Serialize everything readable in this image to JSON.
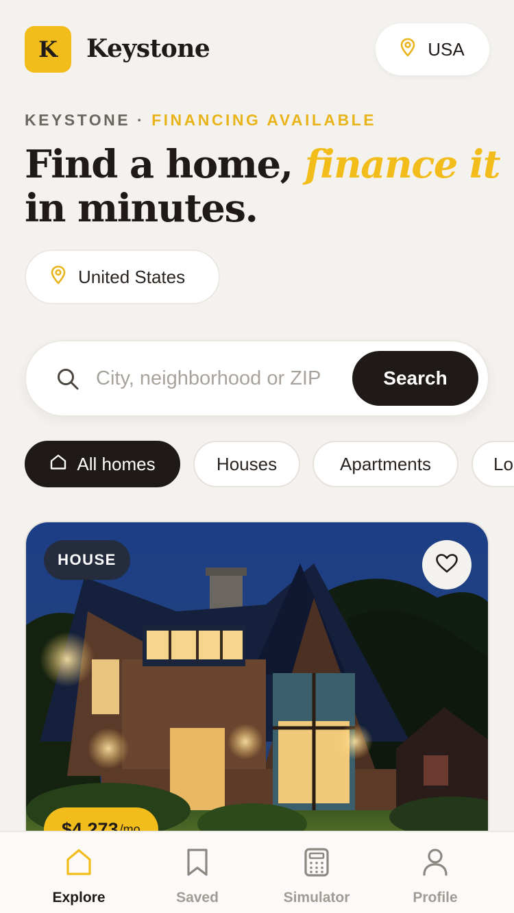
{
  "brand": {
    "logo_letter": "K",
    "name": "Keystone"
  },
  "country_selector": {
    "label": "USA",
    "icon": "location-pin-icon"
  },
  "eyebrow": {
    "brand": "KEYSTONE",
    "separator": " · ",
    "tagline": "FINANCING AVAILABLE"
  },
  "headline": {
    "part1": "Find a home, ",
    "accent": "finance it",
    "part2": "in minutes."
  },
  "location": {
    "label": "United States",
    "icon": "location-pin-icon"
  },
  "search": {
    "placeholder": "City, neighborhood or ZIP",
    "value": "",
    "button_label": "Search",
    "icon": "search-icon"
  },
  "categories": [
    {
      "label": "All homes",
      "active": true,
      "icon": "home-outline-icon"
    },
    {
      "label": "Houses",
      "active": false
    },
    {
      "label": "Apartments",
      "active": false
    },
    {
      "label": "Lo",
      "active": false
    }
  ],
  "listing": {
    "type_badge": "HOUSE",
    "price": "$4,273",
    "price_unit": "/mo",
    "favorite_icon": "heart-outline-icon",
    "saved": false
  },
  "bottom_nav": [
    {
      "label": "Explore",
      "icon": "home-icon",
      "active": true
    },
    {
      "label": "Saved",
      "icon": "bookmark-icon",
      "active": false
    },
    {
      "label": "Simulator",
      "icon": "calculator-icon",
      "active": false
    },
    {
      "label": "Profile",
      "icon": "user-icon",
      "active": false
    }
  ],
  "colors": {
    "accent": "#f2bc1b",
    "dark": "#1f1a17",
    "background": "#f4f2ee",
    "muted": "#a19b95"
  }
}
